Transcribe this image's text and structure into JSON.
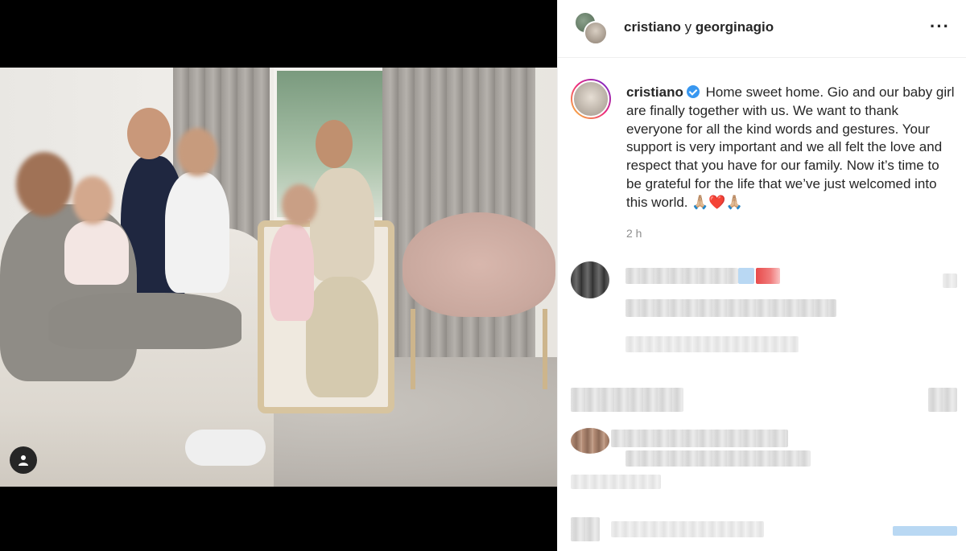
{
  "post": {
    "header": {
      "author1": "cristiano",
      "conjunction": "y",
      "author2": "georginagio",
      "more_icon": "more-horizontal-icon"
    },
    "caption": {
      "username": "cristiano",
      "verified": true,
      "text": "Home sweet home. Gio and our baby girl are finally together with us. We want to thank everyone for all the kind words and gestures. Your support is very important and we all felt the love and respect that you have for our family. Now it’s time to be grateful for the life that we’ve just welcomed into this world. 🙏🏼❤️🙏🏼",
      "time": "2 h"
    },
    "media": {
      "user_tag_icon": "user-tag-icon"
    },
    "comments_redacted": true
  },
  "colors": {
    "verified_badge": "#3897f0",
    "secondary_text": "#8e8e8e",
    "media_bg": "#000000"
  }
}
